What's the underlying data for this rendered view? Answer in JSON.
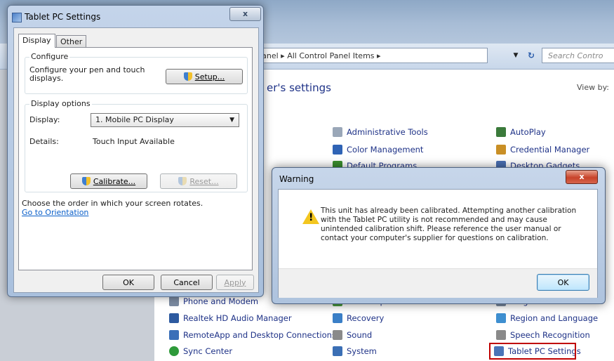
{
  "control_panel": {
    "address_path": "Panel ▸ All Control Panel Items ▸",
    "search_placeholder": "Search Contro",
    "heading": "er's settings",
    "view_by": "View by:",
    "items": [
      {
        "label": "Administrative Tools",
        "color": "#9aa7b8"
      },
      {
        "label": "AutoPlay",
        "color": "#3b7a3b"
      },
      {
        "label": "Color Management",
        "color": "#2f63b5"
      },
      {
        "label": "Credential Manager",
        "color": "#c98f25"
      },
      {
        "label": "Default Programs",
        "color": "#3b8f2e"
      },
      {
        "label": "Desktop Gadgets",
        "color": "#4a6fb2"
      },
      {
        "label": "Phone and Modem",
        "color": "#7a8aa0"
      },
      {
        "label": "Power Options",
        "color": "#4a9a3e"
      },
      {
        "label": "Programs and Features",
        "color": "#7a8aa0"
      },
      {
        "label": "Realtek HD Audio Manager",
        "color": "#2d5aa0"
      },
      {
        "label": "Recovery",
        "color": "#3a7fc7"
      },
      {
        "label": "Region and Language",
        "color": "#3e8fd0"
      },
      {
        "label": "RemoteApp and Desktop Connections",
        "color": "#3a6fb8"
      },
      {
        "label": "Sound",
        "color": "#8a8a8a"
      },
      {
        "label": "Speech Recognition",
        "color": "#8a8a8a"
      },
      {
        "label": "Sync Center",
        "color": "#2e9a3a"
      },
      {
        "label": "System",
        "color": "#3b6fb5"
      },
      {
        "label": "Tablet PC Settings",
        "color": "#4a74b8"
      }
    ],
    "partial_label": "er"
  },
  "tablet_pc_settings": {
    "title": "Tablet PC Settings",
    "close_label": "x",
    "tabs": [
      "Display",
      "Other"
    ],
    "configure": {
      "group_title": "Configure",
      "description": "Configure your pen and touch displays.",
      "setup_button": "Setup..."
    },
    "display_options": {
      "group_title": "Display options",
      "display_label": "Display:",
      "display_value": "1. Mobile PC Display",
      "details_label": "Details:",
      "details_value": "Touch Input Available",
      "calibrate_button": "Calibrate...",
      "reset_button": "Reset..."
    },
    "orientation_text": "Choose the order in which your screen rotates.",
    "orientation_link": "Go to Orientation",
    "ok_button": "OK",
    "cancel_button": "Cancel",
    "apply_button": "Apply"
  },
  "warning_dialog": {
    "title": "Warning",
    "close_label": "x",
    "message": "This unit has already been calibrated.  Attempting another calibration\nwith the Tablet PC utility is not recommended and may cause\nunintended calibration shift.  Please reference the user manual or\ncontact your computer's supplier for questions on calibration.",
    "ok_button": "OK",
    "accent_color": "#f3c61f"
  }
}
